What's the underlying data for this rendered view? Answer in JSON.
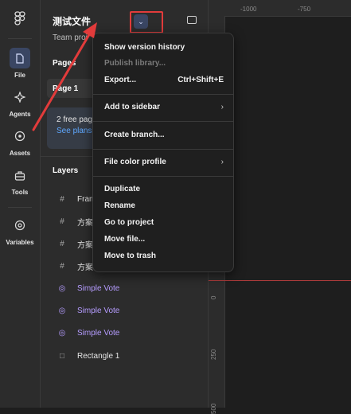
{
  "rail": {
    "items": [
      {
        "label": "File",
        "icon": "file-icon"
      },
      {
        "label": "Agents",
        "icon": "sparkle-icon"
      },
      {
        "label": "Assets",
        "icon": "assets-icon"
      },
      {
        "label": "Tools",
        "icon": "tools-icon"
      },
      {
        "label": "Variables",
        "icon": "variables-icon"
      }
    ]
  },
  "panel": {
    "file_title": "测试文件",
    "team_project": "Team proj",
    "pages_label": "Pages",
    "page1": "Page 1",
    "free_pages": "2 free pag",
    "see_plans": "See plans",
    "layers_label": "Layers",
    "layers": [
      {
        "name": "Fram",
        "icon": "frame-icon"
      },
      {
        "name": "方案",
        "icon": "frame-icon"
      },
      {
        "name": "方案",
        "icon": "frame-icon"
      },
      {
        "name": "方案",
        "icon": "frame-icon"
      },
      {
        "name": "Simple Vote",
        "icon": "component-icon"
      },
      {
        "name": "Simple Vote",
        "icon": "component-icon"
      },
      {
        "name": "Simple Vote",
        "icon": "component-icon"
      },
      {
        "name": "Rectangle 1",
        "icon": "rectangle-icon"
      }
    ]
  },
  "ruler": {
    "top_ticks": [
      "-1000",
      "-750"
    ],
    "left_ticks": [
      "0",
      "250",
      "500"
    ]
  },
  "menu": {
    "items": [
      {
        "label": "Show version history",
        "shortcut": "",
        "submenu": false,
        "disabled": false
      },
      {
        "label": "Publish library...",
        "shortcut": "",
        "submenu": false,
        "disabled": true
      },
      {
        "label": "Export...",
        "shortcut": "Ctrl+Shift+E",
        "submenu": false,
        "disabled": false
      },
      {
        "label": "Add to sidebar",
        "shortcut": "",
        "submenu": true,
        "disabled": false
      },
      {
        "label": "Create branch...",
        "shortcut": "",
        "submenu": false,
        "disabled": false
      },
      {
        "label": "File color profile",
        "shortcut": "",
        "submenu": true,
        "disabled": false
      },
      {
        "label": "Duplicate",
        "shortcut": "",
        "submenu": false,
        "disabled": false
      },
      {
        "label": "Rename",
        "shortcut": "",
        "submenu": false,
        "disabled": false
      },
      {
        "label": "Go to project",
        "shortcut": "",
        "submenu": false,
        "disabled": false
      },
      {
        "label": "Move file...",
        "shortcut": "",
        "submenu": false,
        "disabled": false
      },
      {
        "label": "Move to trash",
        "shortcut": "",
        "submenu": false,
        "disabled": false
      }
    ],
    "chevron": "›"
  },
  "colors": {
    "accent": "#3a4663",
    "annotation_red": "#e23b3b",
    "component_purple": "#b59cff",
    "link_blue": "#5fa8ff"
  }
}
